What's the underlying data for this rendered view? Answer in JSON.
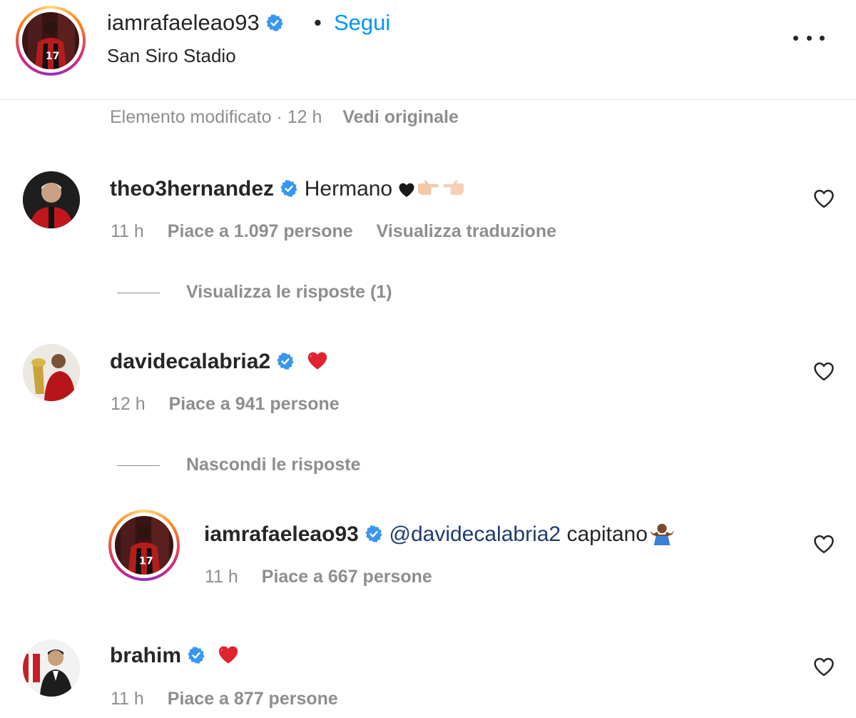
{
  "post": {
    "author": "iamrafaeleao93",
    "separator": "•",
    "follow_label": "Segui",
    "location": "San Siro Stadio",
    "edited_info": "Elemento modificato · 12 h",
    "view_original_label": "Vedi originale"
  },
  "comments": [
    {
      "username": "theo3hernandez",
      "text": "Hermano",
      "time": "11 h",
      "likes": "Piace a 1.097 persone",
      "translate_label": "Visualizza traduzione",
      "replies_toggle": "Visualizza le risposte (1)"
    },
    {
      "username": "davidecalabria2",
      "time": "12 h",
      "likes": "Piace a 941 persone",
      "replies_toggle": "Nascondi le risposte",
      "reply": {
        "username": "iamrafaeleao93",
        "mention": "@davidecalabria2",
        "text": "capitano",
        "time": "11 h",
        "likes": "Piace a 667 persone"
      }
    },
    {
      "username": "brahim",
      "time": "11 h",
      "likes": "Piace a 877 persone"
    }
  ],
  "colors": {
    "verified": "#3897f0",
    "link": "#0095f6",
    "muted": "#8e8e8e",
    "heart_red": "#e0232e"
  }
}
